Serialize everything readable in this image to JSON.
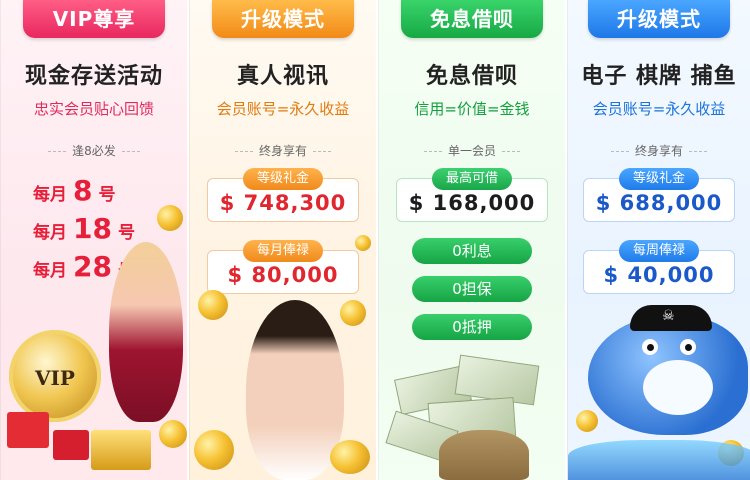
{
  "panels": [
    {
      "tab": "VIP尊享",
      "title": "现金存送活动",
      "subtitle": "忠实会员贴心回馈",
      "divider": "逢8必发",
      "months": [
        {
          "prefix": "每月",
          "number": "8",
          "suffix": "号"
        },
        {
          "prefix": "每月",
          "number": "18",
          "suffix": "号"
        },
        {
          "prefix": "每月",
          "number": "28",
          "suffix": "号"
        }
      ],
      "vip_badge": "VIP",
      "icon": "vip-coin-icon"
    },
    {
      "tab": "升级模式",
      "title": "真人视讯",
      "subtitle": "会员账号=永久收益",
      "divider": "终身享有",
      "boxes": [
        {
          "label": "等级礼金",
          "value": "$ 748,300"
        },
        {
          "label": "每月俸禄",
          "value": "$ 80,000"
        }
      ]
    },
    {
      "tab": "免息借呗",
      "title": "免息借呗",
      "subtitle": "信用=价值=金钱",
      "divider": "单一会员",
      "boxes": [
        {
          "label": "最高可借",
          "value": "$ 168,000"
        }
      ],
      "pills": [
        "0利息",
        "0担保",
        "0抵押"
      ]
    },
    {
      "tab": "升级模式",
      "title": "电子 棋牌 捕鱼",
      "subtitle": "会员账号=永久收益",
      "divider": "终身享有",
      "boxes": [
        {
          "label": "等级礼金",
          "value": "$ 688,000"
        },
        {
          "label": "每周俸禄",
          "value": "$ 40,000"
        }
      ]
    }
  ],
  "colors": {
    "red_tab": "#e8275f",
    "orange_tab": "#f28a17",
    "green_tab": "#17a944",
    "blue_tab": "#1d78e8"
  }
}
